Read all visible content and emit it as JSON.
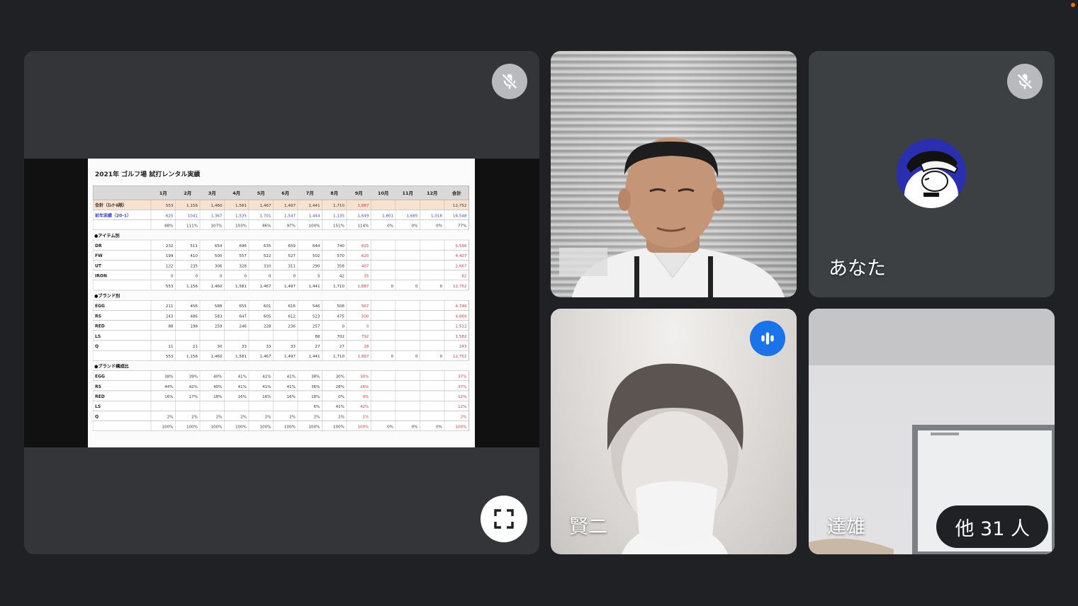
{
  "presentation": {
    "slide_title": "2021年 ゴルフ場 試打レンタル実績",
    "months": [
      "1月",
      "2月",
      "3月",
      "4月",
      "5月",
      "6月",
      "7月",
      "8月",
      "9月",
      "10月",
      "11月",
      "12月",
      "合計"
    ],
    "rows": [
      {
        "label": "合計（ｴﾚｸｰﾙ除）",
        "values": [
          "553",
          "1,156",
          "1,460",
          "1,581",
          "1,467",
          "1,497",
          "1,441",
          "1,710",
          "1,887",
          "",
          "",
          "",
          "12,752"
        ]
      },
      {
        "label": "前年実績（20-1）",
        "values": [
          "625",
          "1041",
          "1,367",
          "1,535",
          "1,701",
          "1,547",
          "1,444",
          "1,135",
          "1,649",
          "1,801",
          "1,685",
          "1,018",
          "16,548"
        ]
      },
      {
        "label": "前年比",
        "values": [
          "88%",
          "111%",
          "107%",
          "103%",
          "86%",
          "97%",
          "100%",
          "151%",
          "114%",
          "0%",
          "0%",
          "0%",
          "77%"
        ]
      }
    ],
    "section_item": "●アイテム別",
    "item_rows": [
      {
        "label": "DR",
        "values": [
          "232",
          "511",
          "654",
          "696",
          "635",
          "659",
          "644",
          "740",
          "825",
          "",
          "",
          "",
          "5,596"
        ]
      },
      {
        "label": "FW",
        "values": [
          "199",
          "410",
          "500",
          "557",
          "522",
          "527",
          "502",
          "570",
          "620",
          "",
          "",
          "",
          "4,407"
        ]
      },
      {
        "label": "UT",
        "values": [
          "122",
          "235",
          "306",
          "328",
          "310",
          "311",
          "290",
          "358",
          "407",
          "",
          "",
          "",
          "2,667"
        ]
      },
      {
        "label": "IRON",
        "values": [
          "0",
          "0",
          "0",
          "0",
          "0",
          "0",
          "5",
          "42",
          "35",
          "",
          "",
          "",
          "82"
        ]
      }
    ],
    "item_total": [
      "553",
      "1,156",
      "1,460",
      "1,581",
      "1,467",
      "1,497",
      "1,441",
      "1,710",
      "1,887",
      "0",
      "0",
      "0",
      "12,752"
    ],
    "section_brand": "●ブランド別",
    "brand_rows": [
      {
        "label": "EGG",
        "values": [
          "211",
          "456",
          "588",
          "655",
          "601",
          "616",
          "546",
          "508",
          "567",
          "",
          "",
          "",
          "4,746"
        ]
      },
      {
        "label": "RS",
        "values": [
          "243",
          "486",
          "583",
          "647",
          "605",
          "612",
          "523",
          "475",
          "500",
          "",
          "",
          "",
          "4,669"
        ]
      },
      {
        "label": "RED",
        "values": [
          "88",
          "198",
          "259",
          "246",
          "228",
          "236",
          "257",
          "0",
          "0",
          "",
          "",
          "",
          "1,512"
        ]
      },
      {
        "label": "LS",
        "values": [
          "",
          "",
          "",
          "",
          "",
          "",
          "88",
          "702",
          "792",
          "",
          "",
          "",
          "1,582"
        ]
      },
      {
        "label": "Q",
        "values": [
          "11",
          "21",
          "30",
          "33",
          "33",
          "33",
          "27",
          "27",
          "28",
          "",
          "",
          "",
          "243"
        ]
      }
    ],
    "brand_total": [
      "553",
      "1,156",
      "1,460",
      "1,581",
      "1,467",
      "1,497",
      "1,441",
      "1,710",
      "1,887",
      "0",
      "0",
      "0",
      "12,752"
    ],
    "section_ratio": "●ブランド構成比",
    "ratio_rows": [
      {
        "label": "EGG",
        "values": [
          "38%",
          "39%",
          "40%",
          "41%",
          "41%",
          "41%",
          "38%",
          "30%",
          "30%",
          "",
          "",
          "",
          "37%"
        ]
      },
      {
        "label": "RS",
        "values": [
          "44%",
          "42%",
          "40%",
          "41%",
          "41%",
          "41%",
          "36%",
          "28%",
          "26%",
          "",
          "",
          "",
          "37%"
        ]
      },
      {
        "label": "RED",
        "values": [
          "16%",
          "17%",
          "18%",
          "16%",
          "16%",
          "16%",
          "18%",
          "0%",
          "0%",
          "",
          "",
          "",
          "12%"
        ]
      },
      {
        "label": "LS",
        "values": [
          "",
          "",
          "",
          "",
          "",
          "",
          "6%",
          "41%",
          "42%",
          "",
          "",
          "",
          "12%"
        ]
      },
      {
        "label": "Q",
        "values": [
          "2%",
          "2%",
          "2%",
          "2%",
          "2%",
          "2%",
          "2%",
          "2%",
          "1%",
          "",
          "",
          "",
          "2%"
        ]
      }
    ],
    "ratio_total": [
      "100%",
      "100%",
      "100%",
      "100%",
      "100%",
      "100%",
      "100%",
      "100%",
      "100%",
      "0%",
      "0%",
      "0%",
      "100%"
    ]
  },
  "participants": {
    "you_label": "あなた",
    "p2_name": "賢二",
    "p3_name": "達雄",
    "others_label": "他 31 人"
  },
  "colors": {
    "background": "#202124",
    "tile": "#3c4043",
    "speaking": "#1a73e8",
    "highlight_red": "#e0383e",
    "highlight_blue": "#3b49d6"
  }
}
